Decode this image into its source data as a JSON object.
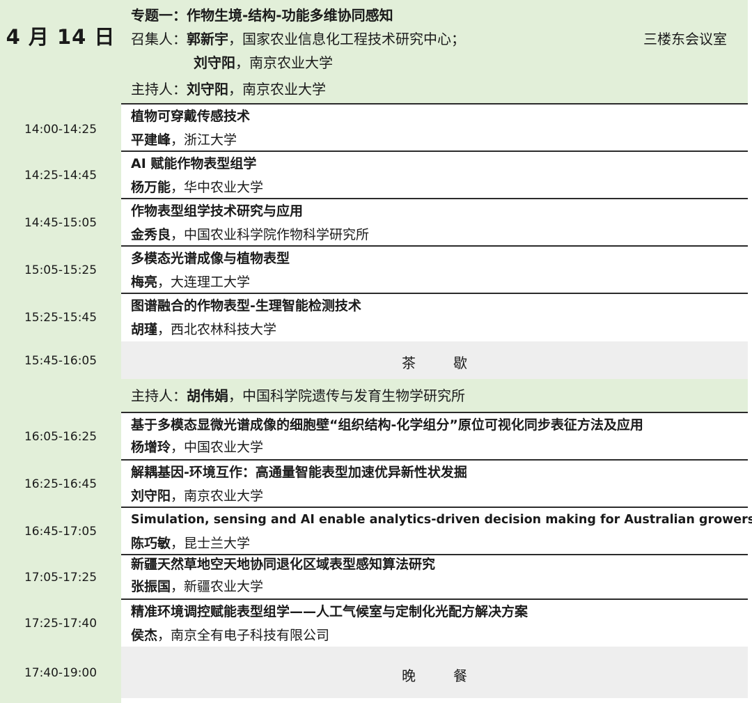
{
  "date": "4 月 14 日",
  "session": {
    "title": "专题一：作物生境-结构-功能多维协同感知",
    "convener_label": "召集人：",
    "convener1_name": "郭新宇",
    "convener1_org": "，国家农业信息化工程技术研究中心；",
    "convener2_name": "刘守阳",
    "convener2_org": "，南京农业大学",
    "room": "三楼东会议室",
    "host_label": "主持人：",
    "host_name": "刘守阳",
    "host_org": "，南京农业大学"
  },
  "talks": [
    {
      "time": "14:00-14:25",
      "title": "植物可穿戴传感技术",
      "name": "平建峰",
      "org": "，浙江大学"
    },
    {
      "time": "14:25-14:45",
      "title": "AI 赋能作物表型组学",
      "name": "杨万能",
      "org": "，华中农业大学"
    },
    {
      "time": "14:45-15:05",
      "title": "作物表型组学技术研究与应用",
      "name": "金秀良",
      "org": "，中国农业科学院作物科学研究所"
    },
    {
      "time": "15:05-15:25",
      "title": "多模态光谱成像与植物表型",
      "name": "梅亮",
      "org": "，大连理工大学"
    },
    {
      "time": "15:25-15:45",
      "title": "图谱融合的作物表型-生理智能检测技术",
      "name": "胡瑾",
      "org": "，西北农林科技大学"
    }
  ],
  "tea_break": {
    "time": "15:45-16:05",
    "label": "茶歇"
  },
  "host2": {
    "label": "主持人：",
    "name": "胡伟娟",
    "org": "，中国科学院遗传与发育生物学研究所"
  },
  "talks2": [
    {
      "time": "16:05-16:25",
      "title": "基于多模态显微光谱成像的细胞壁“组织结构-化学组分”原位可视化同步表征方法及应用",
      "name": "杨增玲",
      "org": "，中国农业大学"
    },
    {
      "time": "16:25-16:45",
      "title": "解耦基因-环境互作：高通量智能表型加速优异新性状发掘",
      "name": "刘守阳",
      "org": "，南京农业大学"
    },
    {
      "time": "16:45-17:05",
      "title": "Simulation, sensing and AI enable analytics-driven decision making for Australian growers",
      "name": "陈巧敏",
      "org": "，昆士兰大学"
    },
    {
      "time": "17:05-17:25",
      "title": "新疆天然草地空天地协同退化区域表型感知算法研究",
      "name": "张振国",
      "org": "，新疆农业大学"
    },
    {
      "time": "17:25-17:40",
      "title": "精准环境调控赋能表型组学——人工气候室与定制化光配方解决方案",
      "name": "侯杰",
      "org": "，南京全有电子科技有限公司"
    }
  ],
  "dinner": {
    "time": "17:40-19:00",
    "label": "晚餐"
  }
}
